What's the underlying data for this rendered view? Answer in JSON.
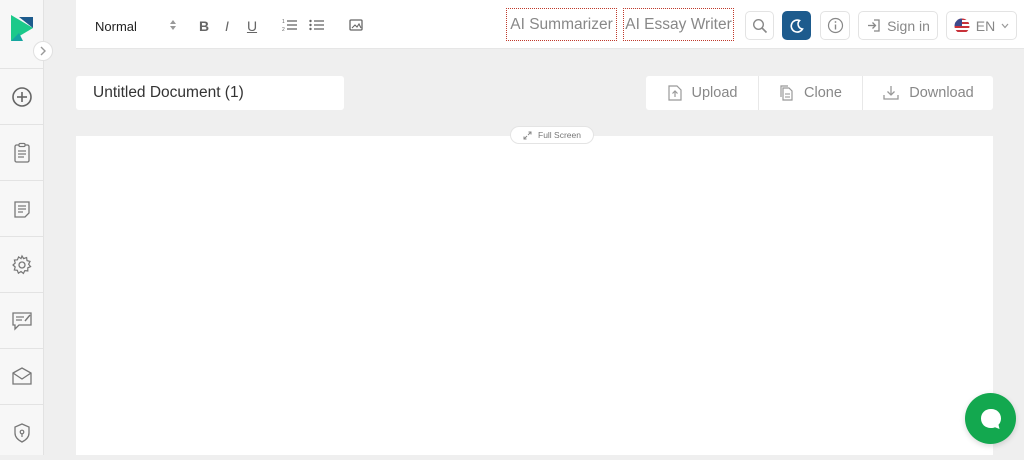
{
  "toolbar": {
    "format_value": "Normal",
    "bold_label": "B",
    "italic_label": "I",
    "underline_label": "U",
    "ai_summarizer_label": "AI Summarizer",
    "ai_essay_writer_label": "AI Essay Writer",
    "sign_in_label": "Sign in",
    "language_label": "EN"
  },
  "document": {
    "title": "Untitled Document (1)",
    "upload_label": "Upload",
    "clone_label": "Clone",
    "download_label": "Download",
    "fullscreen_label": "Full Screen"
  },
  "sidebar": {
    "items": [
      {
        "icon": "add-circle-icon"
      },
      {
        "icon": "clipboard-icon"
      },
      {
        "icon": "document-list-icon"
      },
      {
        "icon": "gear-icon"
      },
      {
        "icon": "feedback-icon"
      },
      {
        "icon": "mail-icon"
      },
      {
        "icon": "shield-icon"
      }
    ]
  },
  "colors": {
    "brand_green": "#1cc98a",
    "brand_blue": "#1d5b8d",
    "chat_green": "#13a84f",
    "ai_border": "#c0392b"
  }
}
